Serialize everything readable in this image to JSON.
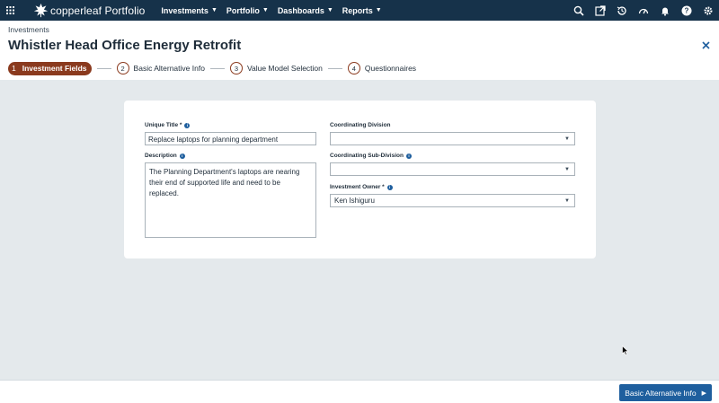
{
  "topbar": {
    "brand": "copperleaf Portfolio",
    "nav": [
      {
        "label": "Investments"
      },
      {
        "label": "Portfolio"
      },
      {
        "label": "Dashboards"
      },
      {
        "label": "Reports"
      }
    ],
    "icons": [
      "search-icon",
      "open-external-icon",
      "history-icon",
      "gauge-icon",
      "bell-icon",
      "help-icon",
      "settings-icon"
    ],
    "colors": {
      "background": "#16324a"
    }
  },
  "header": {
    "breadcrumb": "Investments",
    "title": "Whistler Head Office Energy Retrofit"
  },
  "stepper": {
    "steps": [
      {
        "number": "1",
        "label": "Investment Fields",
        "active": true
      },
      {
        "number": "2",
        "label": "Basic Alternative Info"
      },
      {
        "number": "3",
        "label": "Value Model Selection"
      },
      {
        "number": "4",
        "label": "Questionnaires"
      }
    ],
    "colors": {
      "accent": "#8a3a1e"
    }
  },
  "form": {
    "unique_title": {
      "label": "Unique Title *",
      "value": "Replace laptops for planning department"
    },
    "description": {
      "label": "Description",
      "value": "The Planning Department's laptops are nearing their end of supported life and need to be replaced."
    },
    "coordinating_division": {
      "label": "Coordinating Division",
      "value": ""
    },
    "coordinating_sub_division": {
      "label": "Coordinating Sub-Division",
      "value": ""
    },
    "investment_owner": {
      "label": "Investment Owner *",
      "value": "Ken Ishiguru"
    }
  },
  "footer": {
    "next_label": "Basic Alternative Info",
    "colors": {
      "primary": "#1f5f9e"
    }
  }
}
